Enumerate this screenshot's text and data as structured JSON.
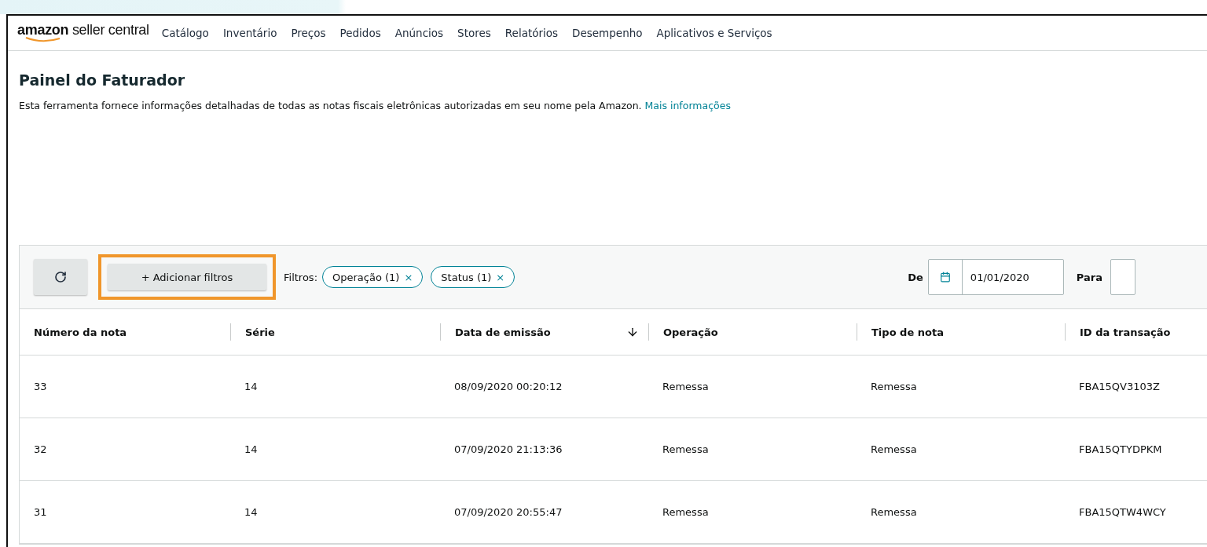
{
  "header": {
    "logo_brand": "amazon",
    "logo_product": "seller central",
    "nav": [
      "Catálogo",
      "Inventário",
      "Preços",
      "Pedidos",
      "Anúncios",
      "Stores",
      "Relatórios",
      "Desempenho",
      "Aplicativos e Serviços"
    ]
  },
  "page": {
    "title": "Painel do Faturador",
    "description": "Esta ferramenta fornece informações detalhadas de todas as notas fiscais eletrônicas autorizadas em seu nome pela Amazon.",
    "link": "Mais informações"
  },
  "toolbar": {
    "add_filters": {
      "label": "+ Adicionar filtros",
      "highlighted": true
    },
    "filters_label": "Filtros:",
    "filters": [
      {
        "label": "Operação (1)",
        "close": "×"
      },
      {
        "label": "Status (1)",
        "close": "×"
      }
    ],
    "from_label": "De",
    "from_value": "01/01/2020",
    "to_label": "Para"
  },
  "table": {
    "columns": [
      {
        "label": "Número da nota",
        "sorted": false
      },
      {
        "label": "Série",
        "sorted": false
      },
      {
        "label": "Data de emissão",
        "sorted": true
      },
      {
        "label": "Operação",
        "sorted": false
      },
      {
        "label": "Tipo de nota",
        "sorted": false
      },
      {
        "label": "ID da transação",
        "sorted": false
      }
    ],
    "rows": [
      [
        "33",
        "14",
        "08/09/2020 00:20:12",
        "Remessa",
        "Remessa",
        "FBA15QV3103Z"
      ],
      [
        "32",
        "14",
        "07/09/2020 21:13:36",
        "Remessa",
        "Remessa",
        "FBA15QTYDPKM"
      ],
      [
        "31",
        "14",
        "07/09/2020 20:55:47",
        "Remessa",
        "Remessa",
        "FBA15QTW4WCY"
      ]
    ]
  }
}
